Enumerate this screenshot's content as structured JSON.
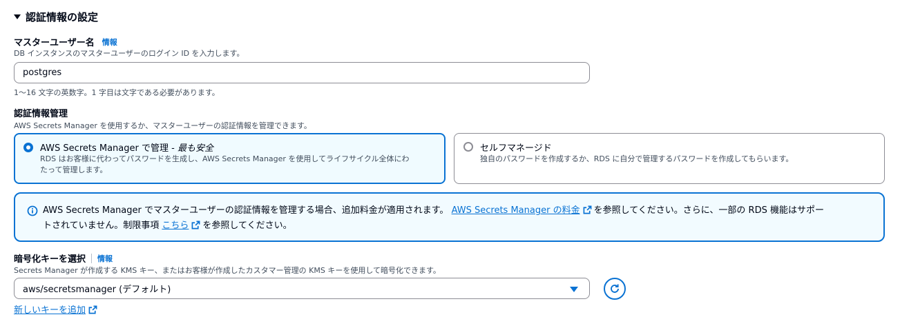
{
  "section": {
    "title": "認証情報の設定"
  },
  "master_username": {
    "label": "マスターユーザー名",
    "info": "情報",
    "description": "DB インスタンスのマスターユーザーのログイン ID を入力します。",
    "value": "postgres",
    "constraint": "1〜16 文字の英数字。1 字目は文字である必要があります。"
  },
  "credentials_management": {
    "label": "認証情報管理",
    "description": "AWS Secrets Manager を使用するか、マスターユーザーの認証情報を管理できます。",
    "options": [
      {
        "title": "AWS Secrets Manager で管理 - ",
        "title_emphasis": "最も安全",
        "description_line1": "RDS はお客様に代わってパスワードを生成し、AWS Secrets Manager を使用してライフサイクル全体にわ",
        "description_line2": "たって管理します。",
        "selected": true
      },
      {
        "title": "セルフマネージド",
        "description": "独自のパスワードを作成するか、RDS に自分で管理するパスワードを作成してもらいます。",
        "selected": false
      }
    ]
  },
  "alert": {
    "text_1": "AWS Secrets Manager でマスターユーザーの認証情報を管理する場合、追加料金が適用されます。",
    "link_1": "AWS Secrets Manager の料金",
    "text_2": "を参照してください。さらに、一部の RDS 機能はサポー",
    "text_3": "トされていません。制限事項",
    "link_2": "こちら",
    "text_4": "を参照してください。"
  },
  "encryption_key": {
    "label": "暗号化キーを選択",
    "info": "情報",
    "description": "Secrets Manager が作成する KMS キー、またはお客様が作成したカスタマー管理の KMS キーを使用して暗号化できます。",
    "selected": "aws/secretsmanager (デフォルト)",
    "add_key_link": "新しいキーを追加"
  },
  "colors": {
    "accent": "#0972d3",
    "text": "#000716",
    "secondary_text": "#414d5c",
    "alert_background": "#f2fbff"
  }
}
